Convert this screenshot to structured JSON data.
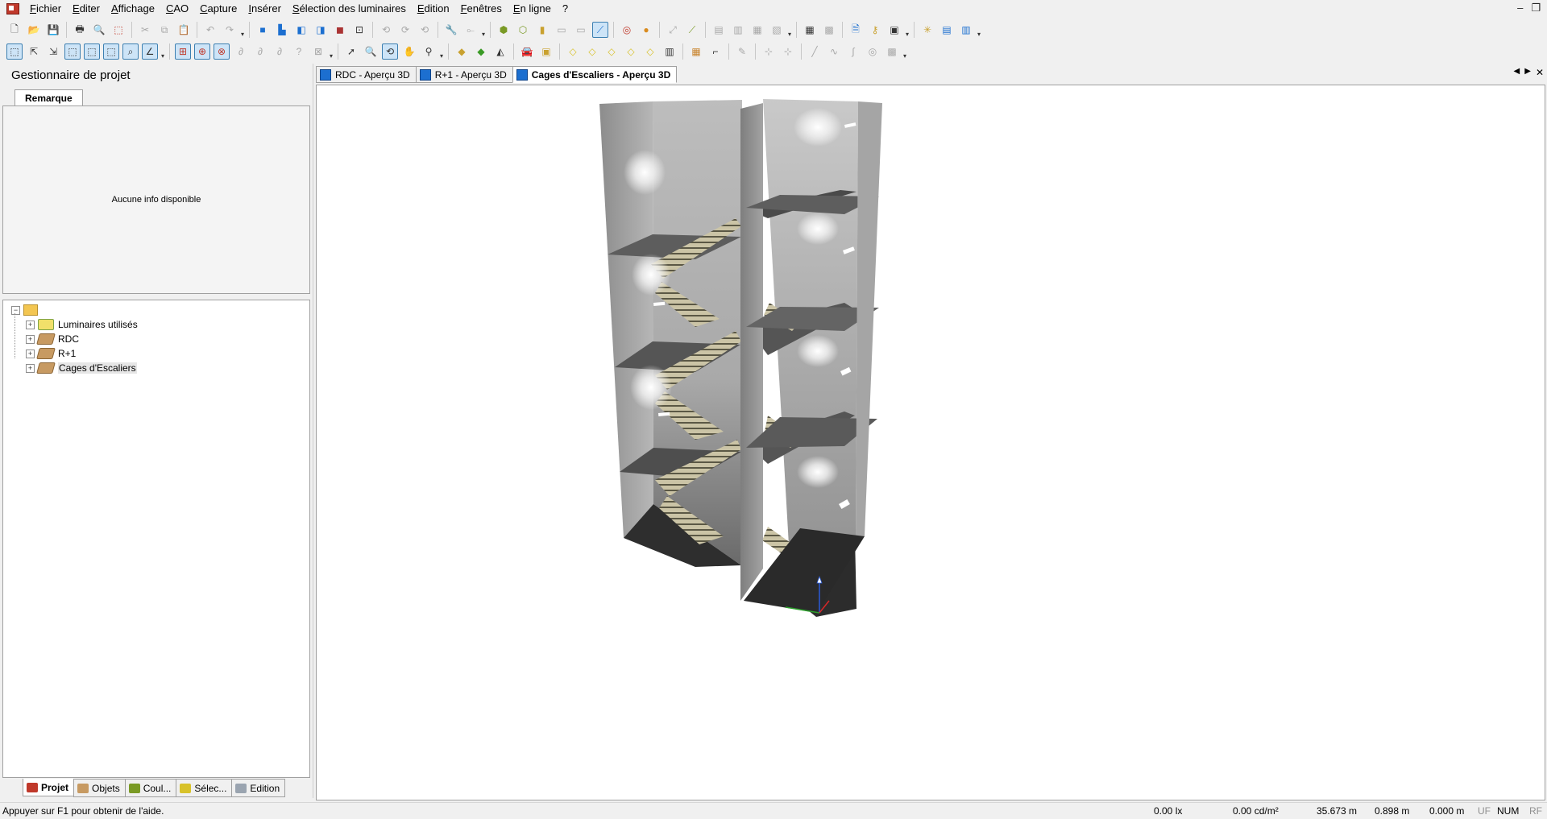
{
  "menu": {
    "items": [
      "Fichier",
      "Editer",
      "Affichage",
      "CAO",
      "Capture",
      "Insérer",
      "Sélection des luminaires",
      "Edition",
      "Fenêtres",
      "En ligne",
      "?"
    ]
  },
  "window_controls": {
    "minimize": "‒",
    "restore": "❐"
  },
  "left_panel": {
    "title": "Gestionnaire de projet",
    "remark_tab": "Remarque",
    "remark_text": "Aucune info disponible",
    "tree": {
      "items": [
        {
          "label": "Luminaires utilisés",
          "icon": "luminaire-icon"
        },
        {
          "label": "RDC",
          "icon": "floor-icon"
        },
        {
          "label": "R+1",
          "icon": "floor-icon"
        },
        {
          "label": "Cages d'Escaliers",
          "icon": "floor-icon"
        }
      ]
    },
    "bottom_tabs": [
      {
        "label": "Projet",
        "active": true
      },
      {
        "label": "Objets",
        "active": false
      },
      {
        "label": "Coul...",
        "active": false
      },
      {
        "label": "Sélec...",
        "active": false
      },
      {
        "label": "Edition",
        "active": false
      }
    ]
  },
  "doc_tabs": [
    {
      "label": "RDC - Aperçu 3D",
      "active": false
    },
    {
      "label": "R+1 - Aperçu 3D",
      "active": false
    },
    {
      "label": "Cages d'Escaliers - Aperçu 3D",
      "active": true
    }
  ],
  "status": {
    "help": "Appuyer sur F1 pour obtenir de l'aide.",
    "illuminance": "0.00 lx",
    "luminance": "0.00 cd/m²",
    "x": "35.673 m",
    "y": "0.898 m",
    "z": "0.000 m",
    "uf": "UF",
    "num": "NUM",
    "rf": "RF"
  },
  "colors": {
    "accent": "#1c6fd0",
    "stair": "#c8c0a0",
    "floor_dark": "#2e2e2e"
  }
}
